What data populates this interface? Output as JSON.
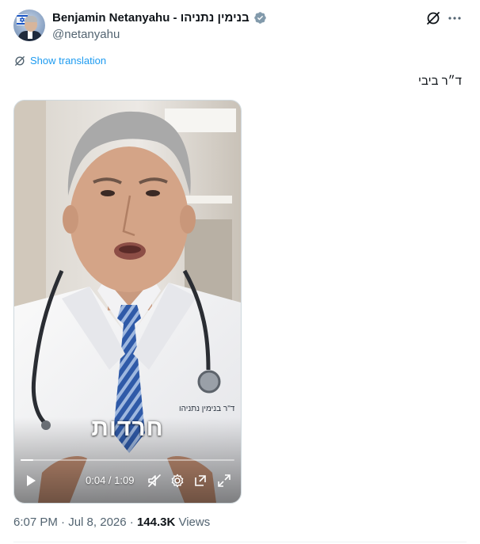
{
  "author": {
    "display_name": "Benjamin Netanyahu - בנימין נתניהו",
    "handle": "@netanyahu",
    "verified": true
  },
  "header_actions": {
    "grok_icon": "grok-icon",
    "more_icon": "more-icon"
  },
  "translation": {
    "label": "Show translation"
  },
  "post": {
    "text": "ד״ר ביבי"
  },
  "video": {
    "caption": "חרדות",
    "coat_badge": "ד\"ר בנימין נתניהו",
    "time": "0:04 / 1:09",
    "progress": 0.058,
    "muted": true
  },
  "meta": {
    "time": "6:07 PM",
    "separator": " · ",
    "date": "Jul 8, 2026",
    "views_count": "144.3K",
    "views_label": " Views"
  },
  "colors": {
    "accent": "#1d9bf0",
    "secondary_text": "#536471",
    "primary_text": "#0f1419"
  }
}
